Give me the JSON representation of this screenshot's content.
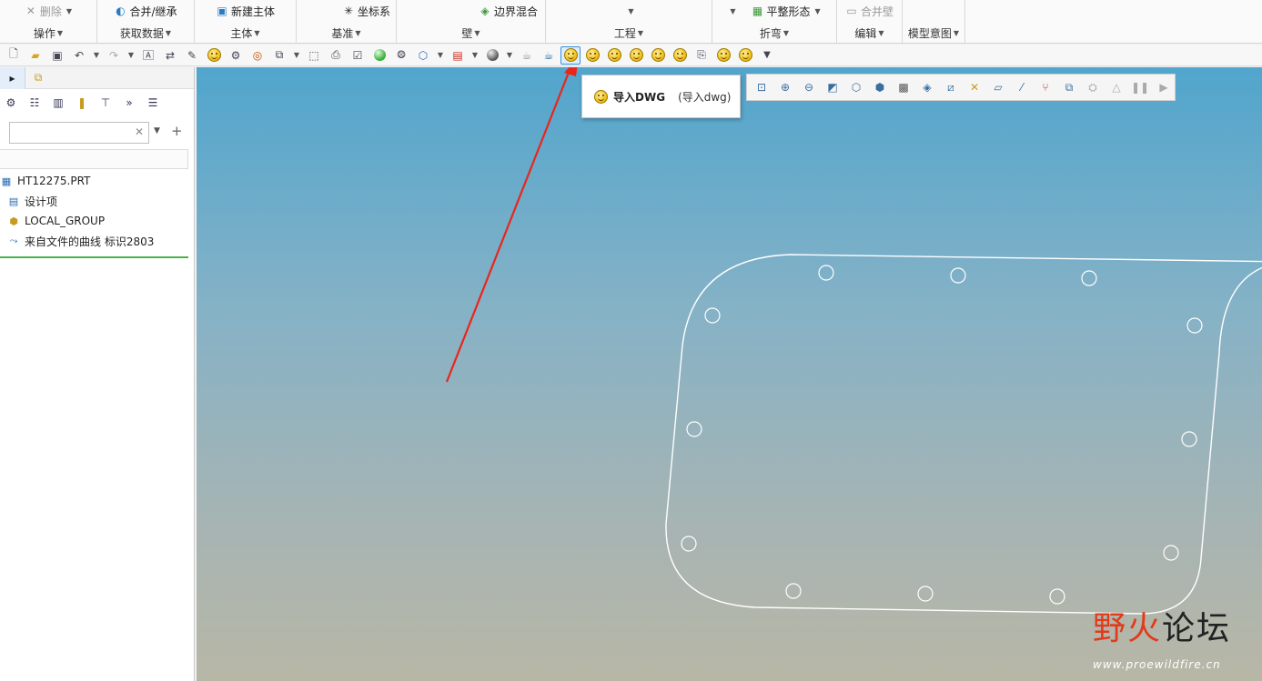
{
  "ribbon": {
    "groups": [
      {
        "top": "删除",
        "bottom": "操作"
      },
      {
        "top": "合并/继承",
        "bottom": "获取数据"
      },
      {
        "top": "新建主体",
        "bottom": "主体"
      },
      {
        "top": "坐标系",
        "bottom": "基准"
      },
      {
        "top": "边界混合",
        "bottom": "壁"
      },
      {
        "top": "",
        "bottom": "工程"
      },
      {
        "top": "平整形态",
        "bottom": "折弯"
      },
      {
        "top": "合并壁",
        "bottom": "编辑"
      },
      {
        "top": "",
        "bottom": "模型意图"
      }
    ]
  },
  "tooltip": {
    "title": "导入DWG",
    "command": "(导入dwg)"
  },
  "model_tree": {
    "filter_placeholder": "",
    "items": [
      {
        "label": "HT12275.PRT",
        "icon": "part-icon"
      },
      {
        "label": "设计项",
        "icon": "design-items-icon"
      },
      {
        "label": "LOCAL_GROUP",
        "icon": "group-icon"
      },
      {
        "label": "来自文件的曲线 标识2803",
        "icon": "curve-icon"
      }
    ]
  },
  "watermark": {
    "brand_a": "野",
    "brand_b": "火",
    "brand_c": "论坛",
    "url": "www.proewildfire.cn"
  },
  "colors": {
    "arrow": "#e8261c",
    "sketch": "#ffffff",
    "accent": "#3a8fd8"
  }
}
